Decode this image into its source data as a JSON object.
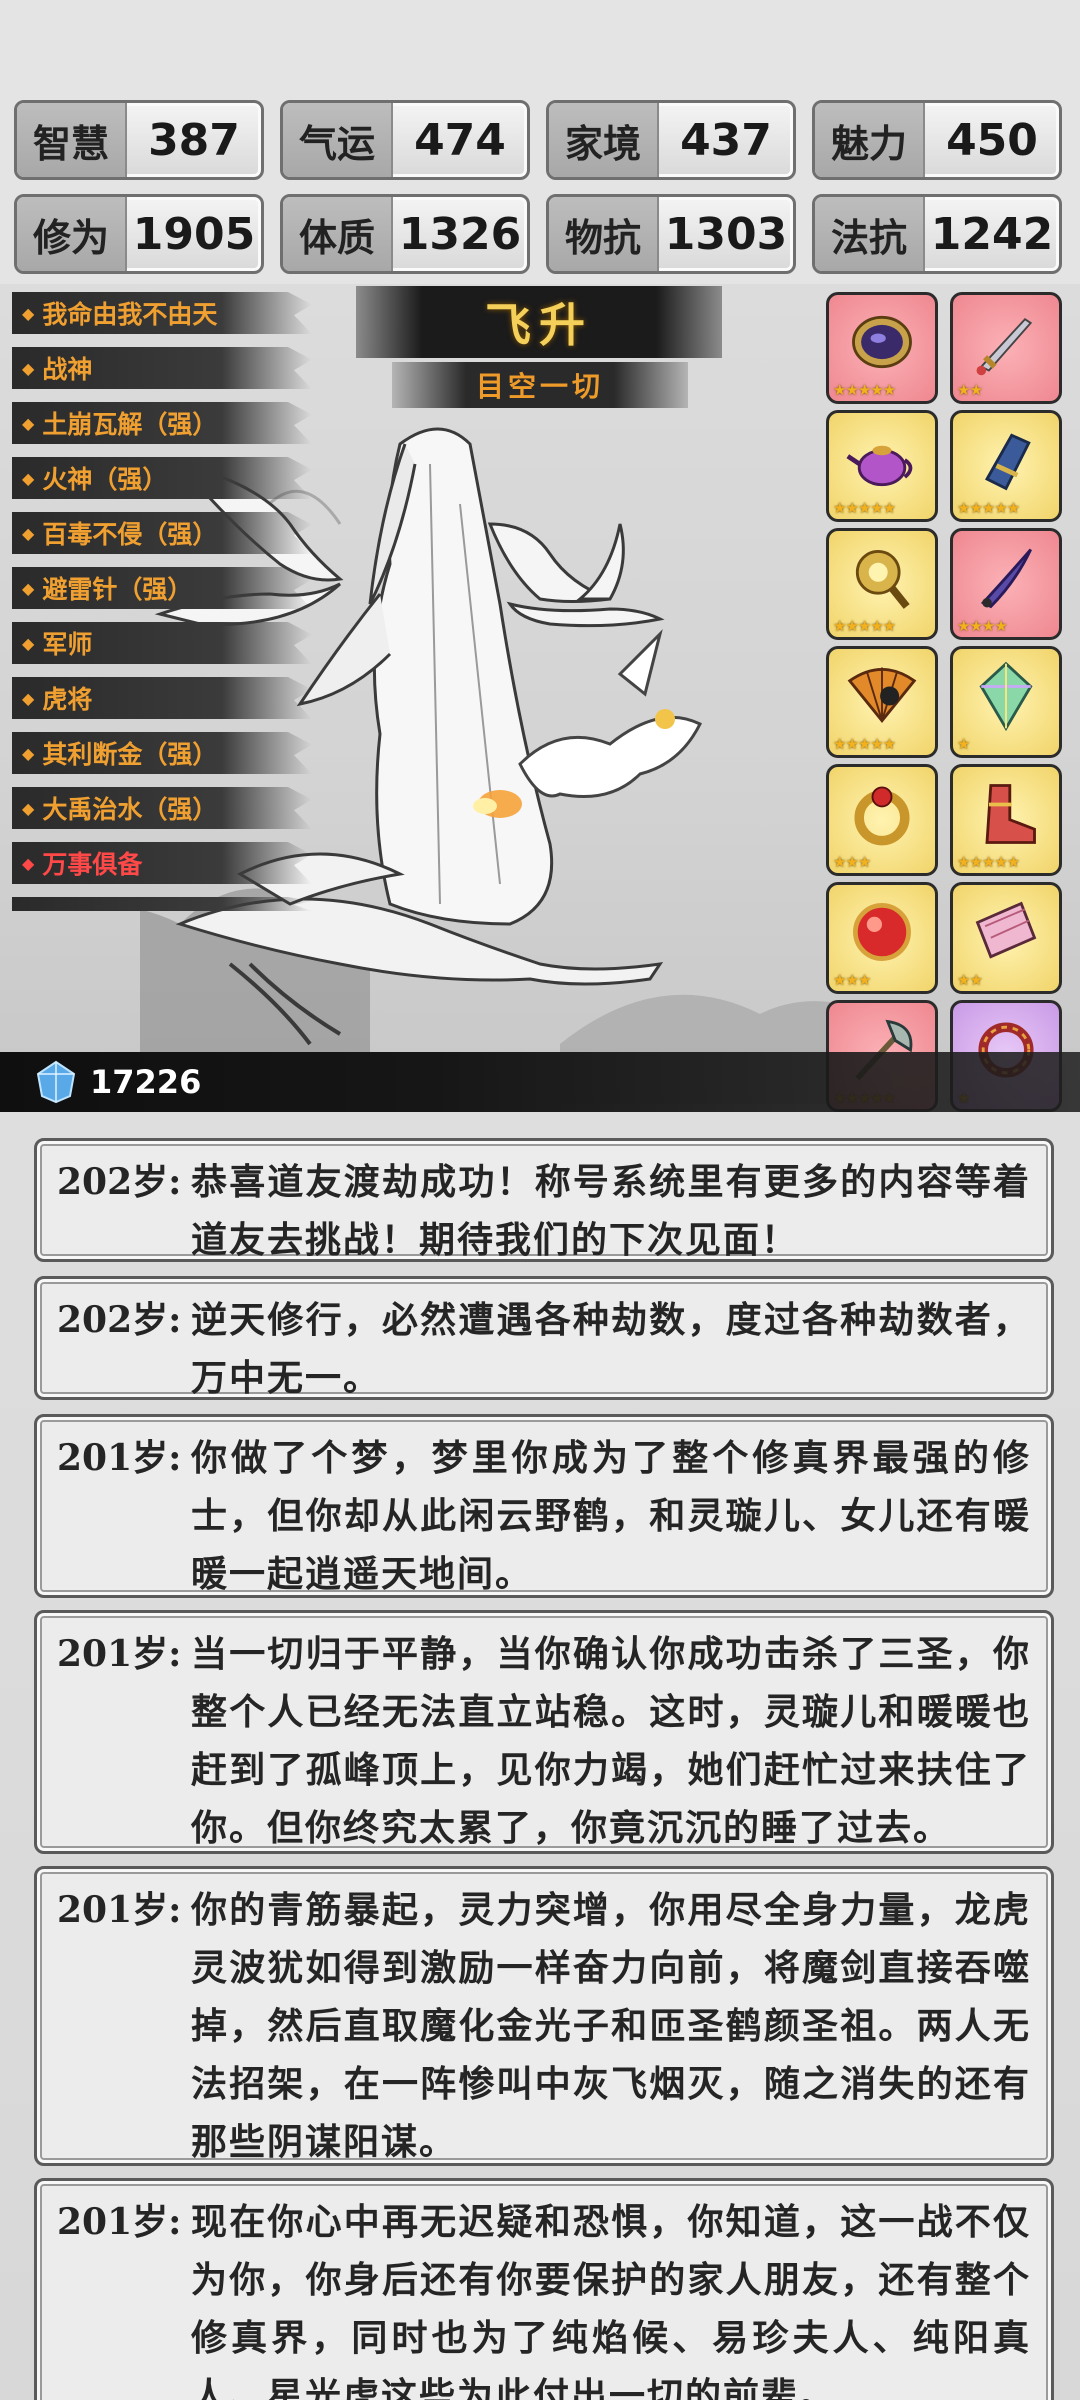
{
  "stats": [
    [
      {
        "label": "智慧",
        "value": "387"
      },
      {
        "label": "气运",
        "value": "474"
      },
      {
        "label": "家境",
        "value": "437"
      },
      {
        "label": "魅力",
        "value": "450"
      }
    ],
    [
      {
        "label": "修为",
        "value": "1905"
      },
      {
        "label": "体质",
        "value": "1326"
      },
      {
        "label": "物抗",
        "value": "1303"
      },
      {
        "label": "法抗",
        "value": "1242"
      }
    ]
  ],
  "skills": [
    {
      "label": "我命由我不由天",
      "color": "orange"
    },
    {
      "label": "战神",
      "color": "orange"
    },
    {
      "label": "土崩瓦解（强）",
      "color": "orange"
    },
    {
      "label": "火神（强）",
      "color": "orange"
    },
    {
      "label": "百毒不侵（强）",
      "color": "orange"
    },
    {
      "label": "避雷针（强）",
      "color": "orange"
    },
    {
      "label": "军师",
      "color": "orange"
    },
    {
      "label": "虎将",
      "color": "orange"
    },
    {
      "label": "其利断金（强）",
      "color": "orange"
    },
    {
      "label": "大禹治水（强）",
      "color": "orange"
    },
    {
      "label": "万事俱备",
      "color": "red"
    }
  ],
  "title": {
    "main": "飞升",
    "sub": "目空一切"
  },
  "items": [
    {
      "name": "mirror-icon",
      "rarity": "red",
      "stars": "★★★★★"
    },
    {
      "name": "sword-icon",
      "rarity": "red",
      "stars": "★★"
    },
    {
      "name": "teapot-icon",
      "rarity": "gold",
      "stars": "★★★★★"
    },
    {
      "name": "gauntlet-icon",
      "rarity": "gold",
      "stars": "★★★★★"
    },
    {
      "name": "rattle-icon",
      "rarity": "gold",
      "stars": "★★★★★"
    },
    {
      "name": "blade-icon",
      "rarity": "red",
      "stars": "★★★★"
    },
    {
      "name": "fan-icon",
      "rarity": "gold",
      "stars": "★★★★★"
    },
    {
      "name": "crystal-icon",
      "rarity": "gold",
      "stars": "★"
    },
    {
      "name": "ring-icon",
      "rarity": "gold",
      "stars": "★★★"
    },
    {
      "name": "boot-icon",
      "rarity": "gold",
      "stars": "★★★★★"
    },
    {
      "name": "orb-icon",
      "rarity": "gold",
      "stars": "★★★"
    },
    {
      "name": "scroll-icon",
      "rarity": "gold",
      "stars": "★★"
    },
    {
      "name": "axe-icon",
      "rarity": "red",
      "stars": "★★★★★"
    },
    {
      "name": "bracelet-icon",
      "rarity": "purple",
      "stars": "★"
    }
  ],
  "currency": {
    "icon": "gem-icon",
    "value": "17226"
  },
  "log": [
    {
      "age": "202岁:",
      "text": "恭喜道友渡劫成功！称号系统里有更多的内容等着道友去挑战！期待我们的下次见面！"
    },
    {
      "age": "202岁:",
      "text": "逆天修行，必然遭遇各种劫数，度过各种劫数者，万中无一。"
    },
    {
      "age": "201岁:",
      "text": "你做了个梦，梦里你成为了整个修真界最强的修士，但你却从此闲云野鹤，和灵璇儿、女儿还有暖暖一起逍遥天地间。"
    },
    {
      "age": "201岁:",
      "text": "当一切归于平静，当你确认你成功击杀了三圣，你整个人已经无法直立站稳。这时，灵璇儿和暖暖也赶到了孤峰顶上，见你力竭，她们赶忙过来扶住了你。但你终究太累了，你竟沉沉的睡了过去。"
    },
    {
      "age": "201岁:",
      "text": "你的青筋暴起，灵力突增，你用尽全身力量，龙虎灵波犹如得到激励一样奋力向前，将魔剑直接吞噬掉，然后直取魔化金光子和匝圣鹤颜圣祖。两人无法招架，在一阵惨叫中灰飞烟灭，随之消失的还有那些阴谋阳谋。"
    },
    {
      "age": "201岁:",
      "text": "现在你心中再无迟疑和恐惧，你知道，这一战不仅为你，你身后还有你要保护的家人朋友，还有整个修真界，同时也为了纯焰候、易珍夫人、纯阳真人、星光虎这些为此付出一切的前辈。"
    }
  ]
}
